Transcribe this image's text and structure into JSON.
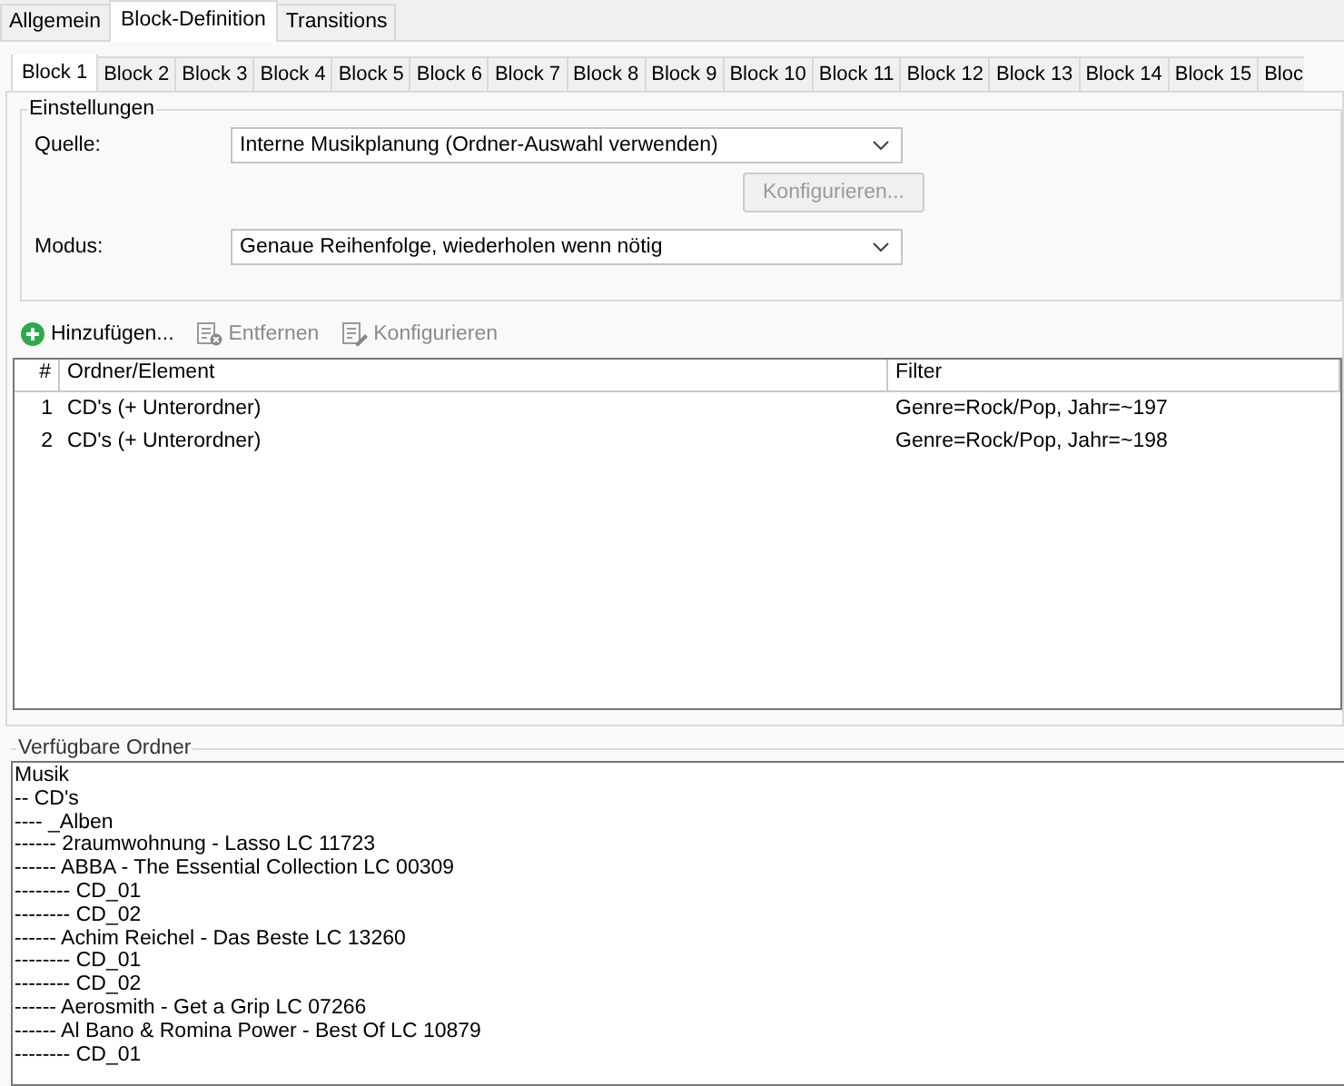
{
  "main_tabs": [
    {
      "label": "Allgemein",
      "selected": false
    },
    {
      "label": "Block-Definition",
      "selected": true
    },
    {
      "label": "Transitions",
      "selected": false
    }
  ],
  "block_tabs": [
    {
      "label": "Block 1",
      "selected": true
    },
    {
      "label": "Block 2",
      "selected": false
    },
    {
      "label": "Block 3",
      "selected": false
    },
    {
      "label": "Block 4",
      "selected": false
    },
    {
      "label": "Block 5",
      "selected": false
    },
    {
      "label": "Block 6",
      "selected": false
    },
    {
      "label": "Block 7",
      "selected": false
    },
    {
      "label": "Block 8",
      "selected": false
    },
    {
      "label": "Block 9",
      "selected": false
    },
    {
      "label": "Block 10",
      "selected": false
    },
    {
      "label": "Block 11",
      "selected": false
    },
    {
      "label": "Block 12",
      "selected": false
    },
    {
      "label": "Block 13",
      "selected": false
    },
    {
      "label": "Block 14",
      "selected": false
    },
    {
      "label": "Block 15",
      "selected": false
    },
    {
      "label": "Bloc",
      "selected": false
    }
  ],
  "settings": {
    "title": "Einstellungen",
    "source_label": "Quelle:",
    "source_value": "Interne Musikplanung (Ordner-Auswahl verwenden)",
    "configure_button": {
      "label": "Konfigurieren...",
      "disabled": true
    },
    "mode_label": "Modus:",
    "mode_value": "Genaue Reihenfolge, wiederholen wenn nötig"
  },
  "toolbar": [
    {
      "kind": "add",
      "label": "Hinzufügen...",
      "disabled": false
    },
    {
      "kind": "remove",
      "label": "Entfernen",
      "disabled": true
    },
    {
      "kind": "configure",
      "label": "Konfigurieren",
      "disabled": true
    }
  ],
  "table": {
    "columns": [
      "#",
      "Ordner/Element",
      "Filter"
    ],
    "rows": [
      [
        "1",
        "CD's (+ Unterordner)",
        "Genre=Rock/Pop, Jahr=~197"
      ],
      [
        "2",
        "CD's (+ Unterordner)",
        "Genre=Rock/Pop, Jahr=~198"
      ]
    ]
  },
  "folders": {
    "title": "Verfügbare Ordner",
    "items": [
      "Musik",
      "-- CD's",
      "---- _Alben",
      "------ 2raumwohnung - Lasso LC 11723",
      "------ ABBA - The Essential Collection LC 00309",
      "-------- CD_01",
      "-------- CD_02",
      "------ Achim Reichel - Das Beste LC 13260",
      "-------- CD_01",
      "-------- CD_02",
      "------ Aerosmith - Get a Grip LC 07266",
      "------ Al Bano & Romina Power - Best Of LC 10879",
      "-------- CD_01"
    ]
  }
}
